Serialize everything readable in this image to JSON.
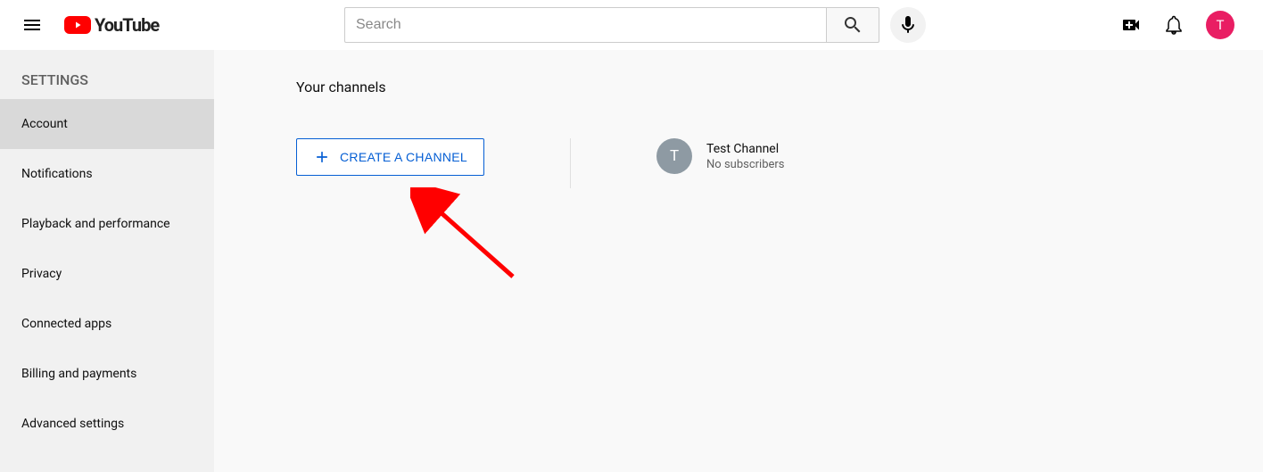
{
  "header": {
    "logo_text": "YouTube",
    "search_placeholder": "Search",
    "avatar_letter": "T"
  },
  "sidebar": {
    "title": "SETTINGS",
    "items": [
      {
        "label": "Account",
        "active": true
      },
      {
        "label": "Notifications",
        "active": false
      },
      {
        "label": "Playback and performance",
        "active": false
      },
      {
        "label": "Privacy",
        "active": false
      },
      {
        "label": "Connected apps",
        "active": false
      },
      {
        "label": "Billing and payments",
        "active": false
      },
      {
        "label": "Advanced settings",
        "active": false
      }
    ]
  },
  "main": {
    "page_title": "Your channels",
    "create_button": "CREATE A CHANNEL",
    "channel": {
      "avatar_letter": "T",
      "name": "Test Channel",
      "subscribers": "No subscribers"
    }
  }
}
